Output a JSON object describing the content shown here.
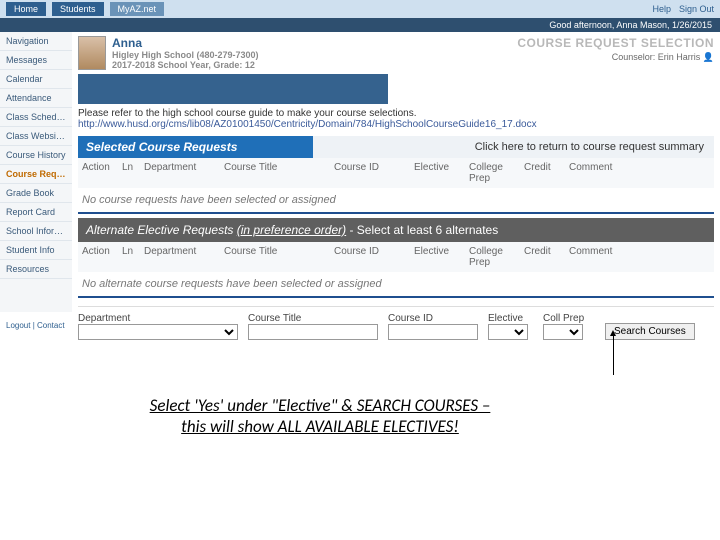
{
  "topbar": {
    "tab_home": "Home",
    "tab_students": "Students",
    "tab_site": "MyAZ.net",
    "help": "Help",
    "signout": "Sign Out"
  },
  "greeting": "Good afternoon, Anna Mason, 1/26/2015",
  "sidebar": {
    "items": [
      "Navigation",
      "Messages",
      "Calendar",
      "Attendance",
      "Class Schedule",
      "Class Websites",
      "Course History",
      "Course Request",
      "Grade Book",
      "Report Card",
      "School Information",
      "Student Info",
      "Resources"
    ]
  },
  "student": {
    "name": "Anna",
    "school": "Higley High School (480-279-7300)",
    "year": "2017-2018 School Year, Grade: 12"
  },
  "page_title": "COURSE REQUEST SELECTION",
  "counselor": {
    "label": "Counselor:",
    "name": "Erin Harris"
  },
  "guide": {
    "text": "Please refer to the high school course guide to make your course selections.",
    "url": "http://www.husd.org/cms/lib08/AZ01001450/Centricity/Domain/784/HighSchoolCourseGuide16_17.docx"
  },
  "selected": {
    "title": "Selected Course Requests",
    "return": "Click here to return to course request summary",
    "empty": "No course requests have been selected or assigned"
  },
  "columns": {
    "action": "Action",
    "ln": "Ln",
    "dept": "Department",
    "title": "Course Title",
    "id": "Course ID",
    "elective": "Elective",
    "prep": "College Prep",
    "credit": "Credit",
    "comment": "Comment"
  },
  "alternate": {
    "title_a": "Alternate Elective Requests ",
    "title_b": "(in preference order)",
    "title_c": " - Select at least 6 alternates",
    "empty": "No alternate course requests have been selected or assigned"
  },
  "search": {
    "dept": "Department",
    "title": "Course Title",
    "id": "Course ID",
    "elective": "Elective",
    "prep": "Coll Prep",
    "button": "Search Courses"
  },
  "footer": {
    "logout": "Logout",
    "contact": "Contact"
  },
  "annotation": {
    "line1": "Select 'Yes' under \"Elective\" & SEARCH COURSES –",
    "line2": "this will show ALL AVAILABLE ELECTIVES!"
  }
}
